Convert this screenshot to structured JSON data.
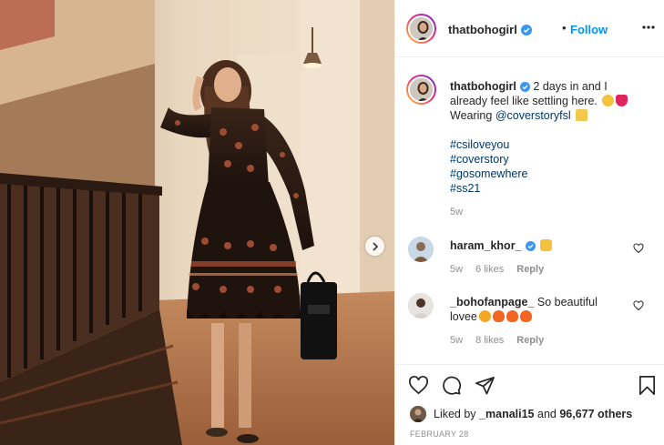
{
  "post": {
    "username": "thatbohogirl",
    "follow_label": "Follow",
    "separator": "•",
    "caption": {
      "username": "thatbohogirl",
      "text_line1": "2 days in and I",
      "text_line2": "already feel like settling here.",
      "text_line3_prefix": "Wearing",
      "mention": "@coverstoryfsl",
      "hashtags": [
        "#csiloveyou",
        "#coverstory",
        "#gosomewhere",
        "#ss21"
      ],
      "age": "5w"
    },
    "comments": [
      {
        "username": "haram_khor_",
        "text": "",
        "emoji": "hands-up",
        "age": "5w",
        "likes": "6 likes",
        "reply": "Reply"
      },
      {
        "username": "_bohofanpage_",
        "text": "So beautiful",
        "text_line2": "lovee",
        "emoji": "heart-eyes-fire",
        "age": "5w",
        "likes": "8 likes",
        "reply": "Reply"
      }
    ],
    "liked_by": {
      "prefix": "Liked by",
      "user": "_manali15",
      "middle": "and",
      "count": "96,677 others"
    },
    "date": "FEBRUARY 28"
  },
  "colors": {
    "accent": "#0095f6",
    "text": "#262626",
    "muted": "#8e8e8e",
    "hashtag": "#00376b",
    "border": "#efefef",
    "like_heart": "#ed4956"
  },
  "icons": [
    "verified-badge-icon",
    "more-options-icon",
    "heart-icon",
    "comment-icon",
    "share-icon",
    "bookmark-icon",
    "chevron-right-icon"
  ]
}
